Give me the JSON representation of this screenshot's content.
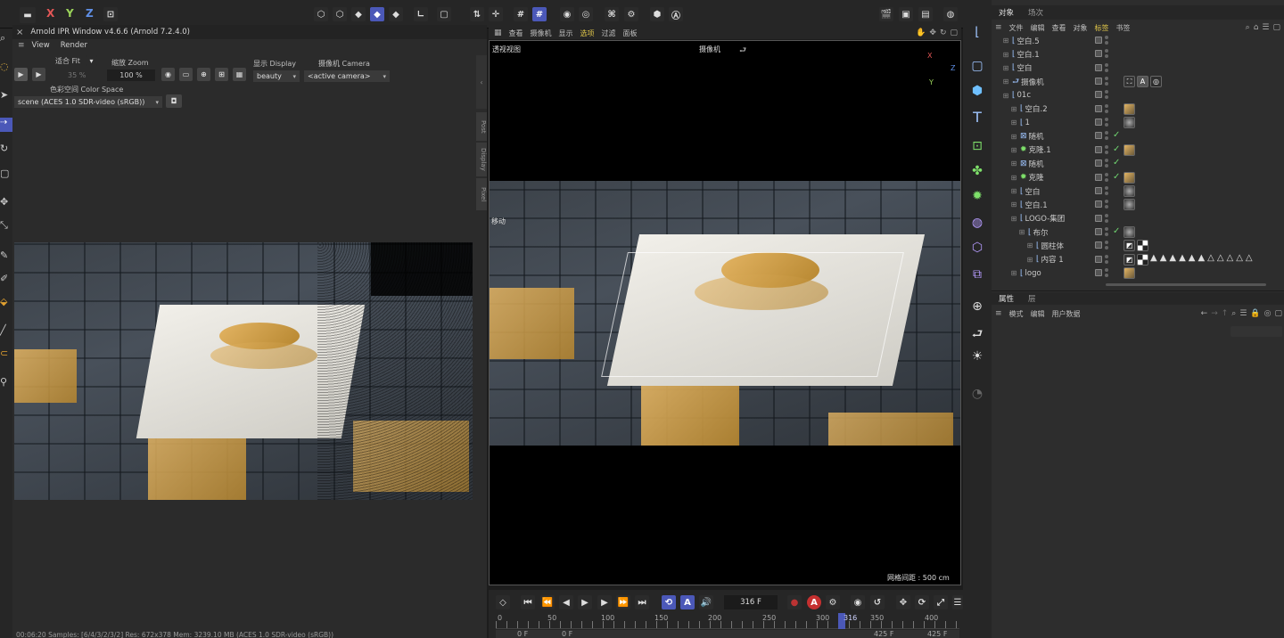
{
  "arnold": {
    "title": "Arnold IPR Window v4.6.6 (Arnold 7.2.4.0)",
    "menu": [
      "View",
      "Render"
    ],
    "fit_label": "适合 Fit",
    "fit_value": "35 %",
    "zoom_label": "缩放 Zoom",
    "zoom_value": "100 %",
    "display_label": "显示 Display",
    "display_value": "beauty",
    "camera_label": "摄像机 Camera",
    "camera_value": "<active camera>",
    "colorspace_label": "色彩空间 Color Space",
    "colorspace_value": "scene (ACES 1.0 SDR-video (sRGB))",
    "side_tabs": [
      "Post",
      "Display",
      "Pixel"
    ],
    "status": "00:06:20  Samples: [6/4/3/2/3/2]  Res: 672x378  Mem: 3239.10 MB  (ACES 1.0 SDR-video (sRGB))"
  },
  "viewport": {
    "menu": [
      "查看",
      "摄像机",
      "显示",
      "选项",
      "过滤",
      "面板"
    ],
    "active_menu_index": 3,
    "view_label": "透视视图",
    "camera_label": "摄像机",
    "move_label": "移动",
    "grid_label": "网格间距 : 500 cm",
    "axes": {
      "x": "X",
      "y": "Y",
      "z": "Z"
    }
  },
  "top_axes": {
    "x": "X",
    "y": "Y",
    "z": "Z"
  },
  "timeline": {
    "frame": "316 F",
    "ticks": [
      "0",
      "50",
      "100",
      "150",
      "200",
      "250",
      "300",
      "350",
      "400"
    ],
    "current": "316",
    "start_a": "0 F",
    "start_b": "0 F",
    "end_a": "425 F",
    "end_b": "425 F",
    "current_fraction": 0.744,
    "record_label": "A"
  },
  "objects": {
    "tabs": [
      "对象",
      "场次"
    ],
    "menu": [
      "文件",
      "编辑",
      "查看",
      "对象",
      "标签",
      "书签"
    ],
    "active_menu_index": 4,
    "rows": [
      {
        "name": "空白.5",
        "indent": 0,
        "check": false,
        "tag": "none"
      },
      {
        "name": "空白.1",
        "indent": 0,
        "check": false,
        "tag": "none"
      },
      {
        "name": "空白",
        "indent": 0,
        "check": false,
        "tag": "none"
      },
      {
        "name": "摄像机",
        "indent": 0,
        "check": false,
        "tag": "camera"
      },
      {
        "name": "01c",
        "indent": 0,
        "check": false,
        "tag": "none"
      },
      {
        "name": "空白.2",
        "indent": 1,
        "check": false,
        "tag": "material"
      },
      {
        "name": "1",
        "indent": 1,
        "check": false,
        "tag": "sphere"
      },
      {
        "name": "随机",
        "indent": 1,
        "check": true,
        "tag": "none"
      },
      {
        "name": "克隆.1",
        "indent": 1,
        "check": true,
        "tag": "material"
      },
      {
        "name": "随机",
        "indent": 1,
        "check": true,
        "tag": "none"
      },
      {
        "name": "克隆",
        "indent": 1,
        "check": true,
        "tag": "material"
      },
      {
        "name": "空白",
        "indent": 1,
        "check": false,
        "tag": "sphere"
      },
      {
        "name": "空白.1",
        "indent": 1,
        "check": false,
        "tag": "sphere"
      },
      {
        "name": "LOGO-集团",
        "indent": 1,
        "check": false,
        "tag": "none"
      },
      {
        "name": "布尔",
        "indent": 2,
        "check": true,
        "tag": "sphere"
      },
      {
        "name": "圆柱体",
        "indent": 3,
        "check": false,
        "tag": "checker"
      },
      {
        "name": "内容 1",
        "indent": 3,
        "check": false,
        "tag": "triangles"
      },
      {
        "name": "logo",
        "indent": 1,
        "check": false,
        "tag": "material"
      }
    ]
  },
  "attributes": {
    "tabs": [
      "属性",
      "层"
    ],
    "menu": [
      "模式",
      "编辑",
      "用户数据"
    ]
  }
}
